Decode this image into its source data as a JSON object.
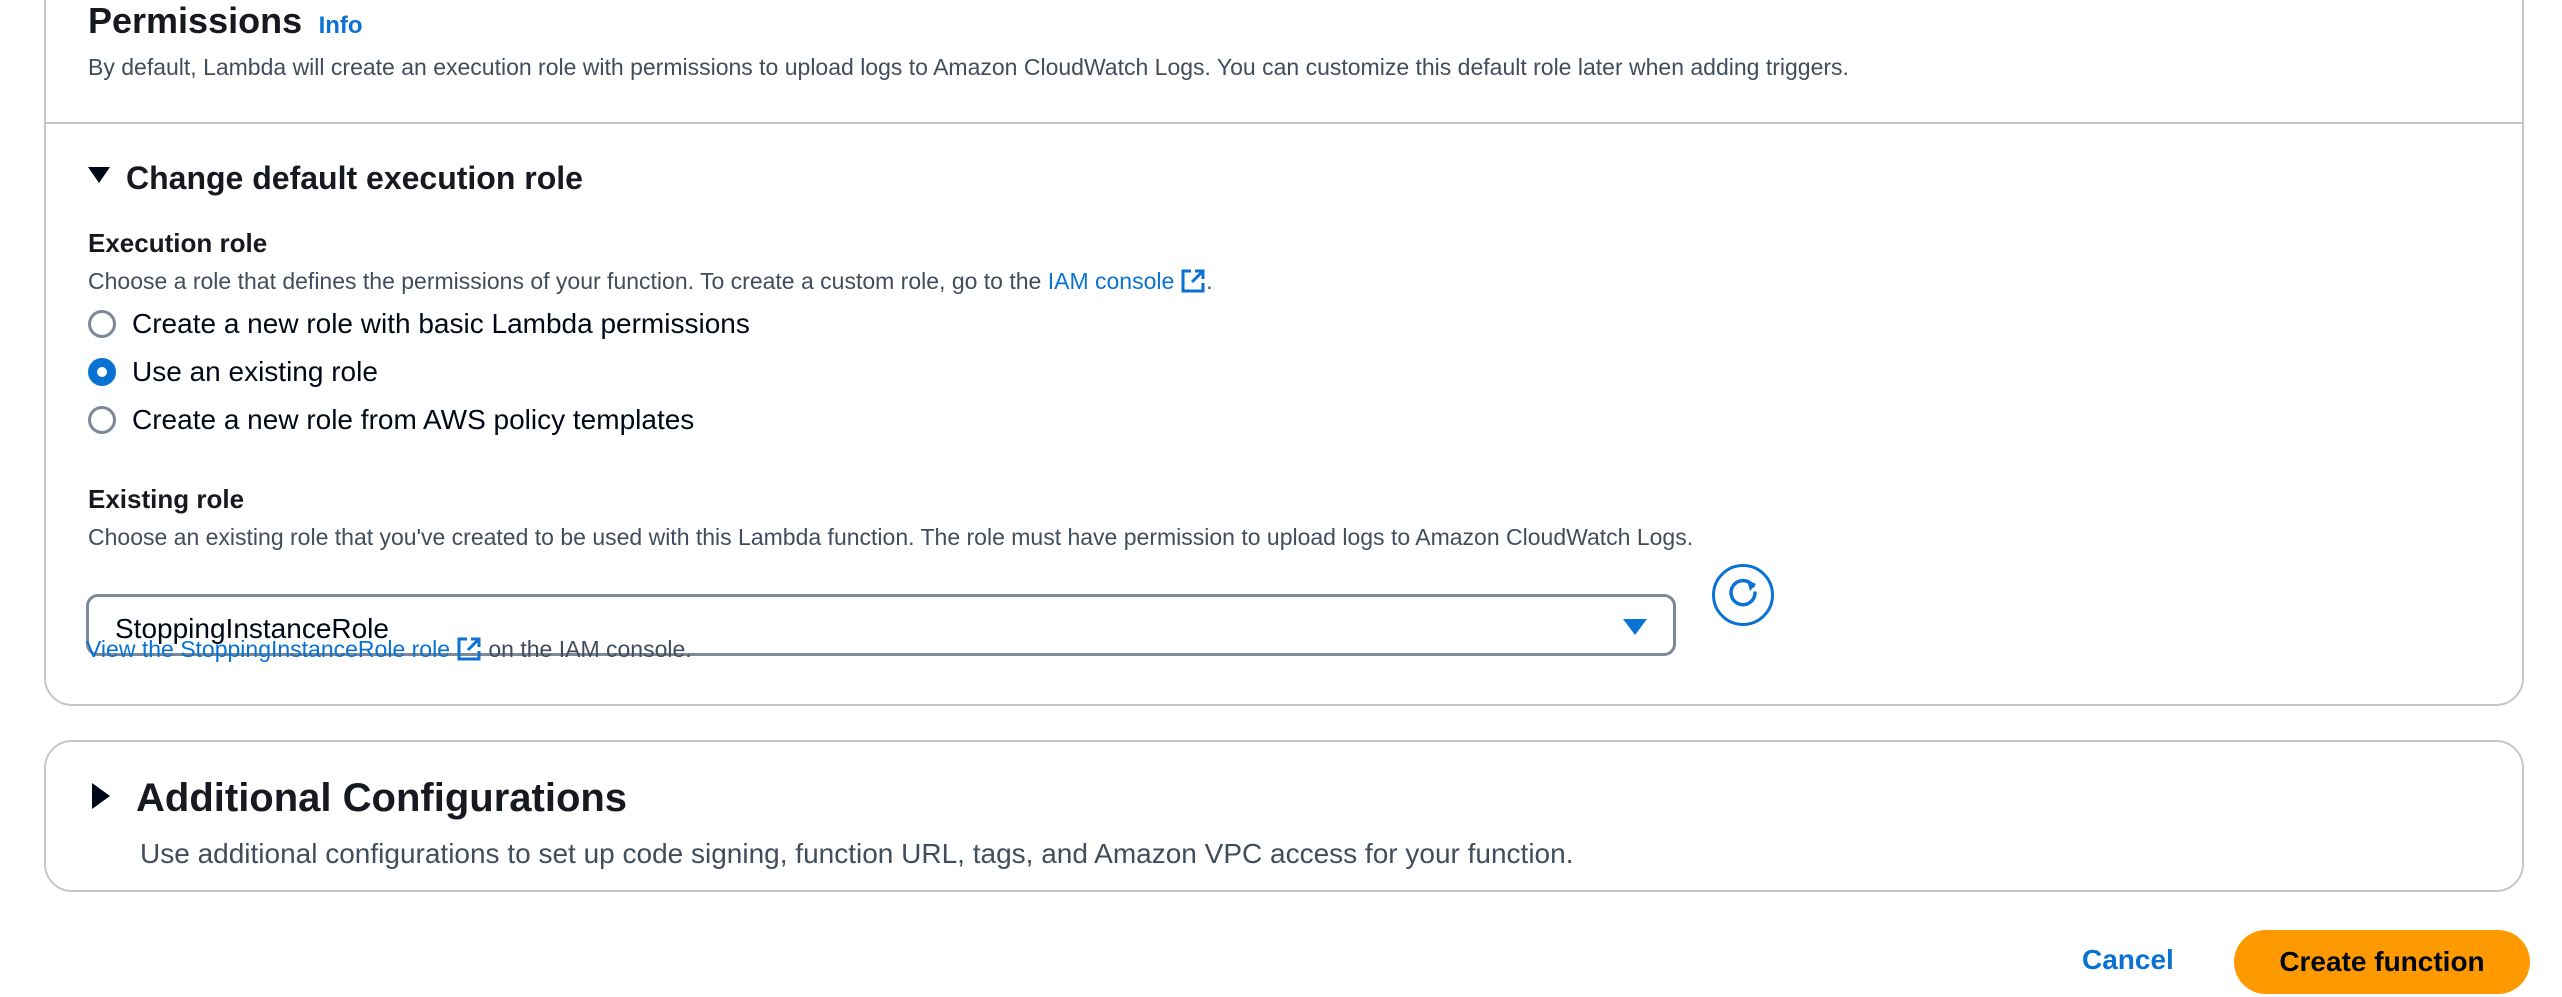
{
  "permissions": {
    "title": "Permissions",
    "info_link": "Info",
    "description": "By default, Lambda will create an execution role with permissions to upload logs to Amazon CloudWatch Logs. You can customize this default role later when adding triggers.",
    "expander": {
      "label": "Change default execution role",
      "expanded": true
    },
    "execution_role": {
      "label": "Execution role",
      "description_prefix": "Choose a role that defines the permissions of your function. To create a custom role, go to the ",
      "description_link": "IAM console",
      "description_suffix": ".",
      "options": [
        {
          "label": "Create a new role with basic Lambda permissions",
          "checked": false
        },
        {
          "label": "Use an existing role",
          "checked": true
        },
        {
          "label": "Create a new role from AWS policy templates",
          "checked": false
        }
      ]
    },
    "existing_role": {
      "label": "Existing role",
      "description": "Choose an existing role that you've created to be used with this Lambda function. The role must have permission to upload logs to Amazon CloudWatch Logs.",
      "selected_value": "StoppingInstanceRole",
      "view_link": "View the StoppingInstanceRole role",
      "view_suffix": "on the IAM console."
    }
  },
  "additional": {
    "title": "Additional Configurations",
    "description": "Use additional configurations to set up code signing, function URL, tags, and Amazon VPC access for your function.",
    "expanded": false
  },
  "actions": {
    "cancel": "Cancel",
    "create": "Create function"
  },
  "colors": {
    "link": "#0972d3",
    "primary_button": "#ff9900",
    "border": "#c6c6cd"
  },
  "icons": {
    "expander_open": "caret-down-icon",
    "expander_closed": "caret-right-icon",
    "external": "external-link-icon",
    "refresh": "refresh-icon",
    "select": "chevron-down-icon"
  }
}
